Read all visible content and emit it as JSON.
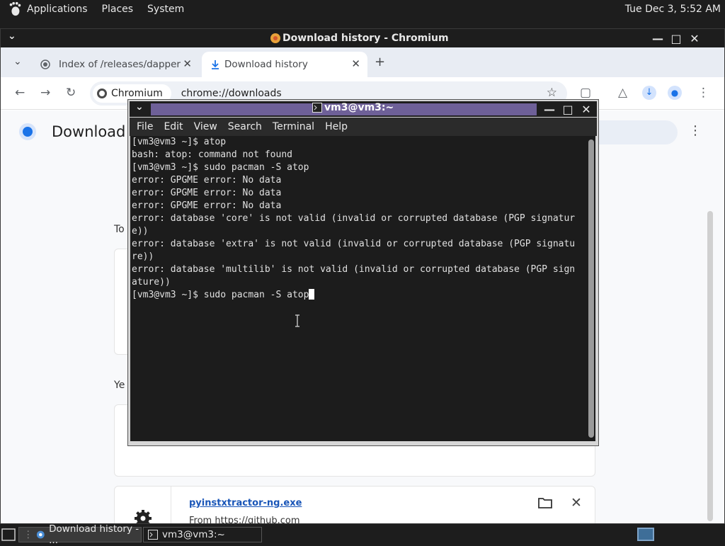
{
  "top_panel": {
    "menus": [
      "Applications",
      "Places",
      "System"
    ],
    "clock": "Tue Dec  3,  5:52 AM"
  },
  "chromium": {
    "window_title": "Download history - Chromium",
    "tabs": [
      {
        "label": "Index of /releases/dapper",
        "active": false
      },
      {
        "label": "Download history",
        "active": true
      }
    ],
    "omnibox": {
      "chip": "Chromium",
      "url": "chrome://downloads"
    },
    "page": {
      "title": "Download",
      "section_today": "To",
      "section_yesterday": "Ye",
      "download": {
        "filename": "pyinstxtractor-ng.exe",
        "from_label": "From",
        "from_url": "https://github.com"
      }
    }
  },
  "terminal": {
    "window_title": "vm3@vm3:~",
    "menu": [
      "File",
      "Edit",
      "View",
      "Search",
      "Terminal",
      "Help"
    ],
    "lines": [
      "[vm3@vm3 ~]$ atop",
      "bash: atop: command not found",
      "[vm3@vm3 ~]$ sudo pacman -S atop",
      "error: GPGME error: No data",
      "error: GPGME error: No data",
      "error: GPGME error: No data",
      "error: database 'core' is not valid (invalid or corrupted database (PGP signatur",
      "e))",
      "error: database 'extra' is not valid (invalid or corrupted database (PGP signatu",
      "re))",
      "error: database 'multilib' is not valid (invalid or corrupted database (PGP sign",
      "ature))"
    ],
    "prompt_line": "[vm3@vm3 ~]$ sudo pacman -S atop"
  },
  "taskbar": {
    "tasks": [
      "Download history - ...",
      "vm3@vm3:~"
    ]
  },
  "colors": {
    "accent": "#1a73e8",
    "terminal_title": "#6e6098",
    "link": "#1a56b8"
  }
}
